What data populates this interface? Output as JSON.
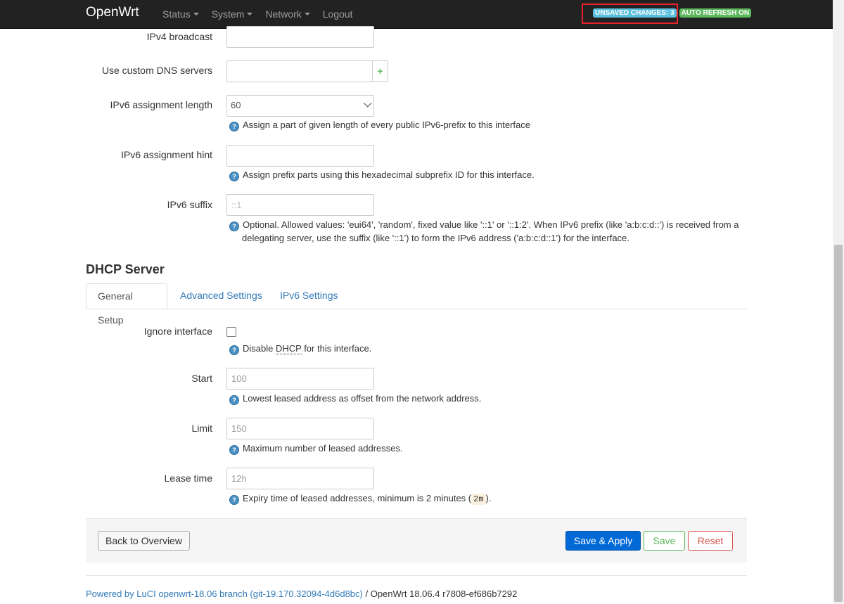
{
  "navbar": {
    "brand": "OpenWrt",
    "menu": [
      {
        "label": "Status",
        "dropdown": true
      },
      {
        "label": "System",
        "dropdown": true
      },
      {
        "label": "Network",
        "dropdown": true
      },
      {
        "label": "Logout",
        "dropdown": false
      }
    ],
    "unsaved_changes": "UNSAVED CHANGES: 3",
    "auto_refresh": "AUTO REFRESH ON"
  },
  "interface_form": {
    "ipv4_broadcast": {
      "label": "IPv4 broadcast",
      "value": ""
    },
    "custom_dns": {
      "label": "Use custom DNS servers",
      "value": "",
      "add_symbol": "+"
    },
    "ipv6_assignment_length": {
      "label": "IPv6 assignment length",
      "value": "60",
      "help": "Assign a part of given length of every public IPv6-prefix to this interface"
    },
    "ipv6_assignment_hint": {
      "label": "IPv6 assignment hint",
      "value": "",
      "help": "Assign prefix parts using this hexadecimal subprefix ID for this interface."
    },
    "ipv6_suffix": {
      "label": "IPv6 suffix",
      "placeholder": "::1",
      "help_line1": "Optional. Allowed values: 'eui64', 'random', fixed value like '::1' or '::1:2'. When IPv6 prefix (like 'a:b:c:d::') is received from a",
      "help_line2": "delegating server, use the suffix (like '::1') to form the IPv6 address ('a:b:c:d::1') for the interface."
    }
  },
  "dhcp_server": {
    "title": "DHCP Server",
    "tabs": [
      "General Setup",
      "Advanced Settings",
      "IPv6 Settings"
    ],
    "active_tab": "General Setup",
    "ignore_interface": {
      "label": "Ignore interface",
      "checked": false,
      "help_prefix": "Disable ",
      "help_abbr": "DHCP",
      "help_suffix": " for this interface."
    },
    "start": {
      "label": "Start",
      "placeholder": "100",
      "help": "Lowest leased address as offset from the network address."
    },
    "limit": {
      "label": "Limit",
      "placeholder": "150",
      "help": "Maximum number of leased addresses."
    },
    "lease_time": {
      "label": "Lease time",
      "placeholder": "12h",
      "help_prefix": "Expiry time of leased addresses, minimum is 2 minutes (",
      "help_code": "2m",
      "help_suffix": ")."
    }
  },
  "actions": {
    "back": "Back to Overview",
    "save_apply": "Save & Apply",
    "save": "Save",
    "reset": "Reset"
  },
  "footer": {
    "link_text": "Powered by LuCI openwrt-18.06 branch (git-19.170.32094-4d6d8bc)",
    "separator": " / ",
    "version": "OpenWrt 18.06.4 r7808-ef686b7292"
  },
  "colors": {
    "navbar_bg": "#222222",
    "badge_changes": "#5bc0de",
    "badge_refresh": "#5cb85c",
    "primary": "#0069d6",
    "highlight": "#e8222a",
    "link": "#337ab7"
  }
}
